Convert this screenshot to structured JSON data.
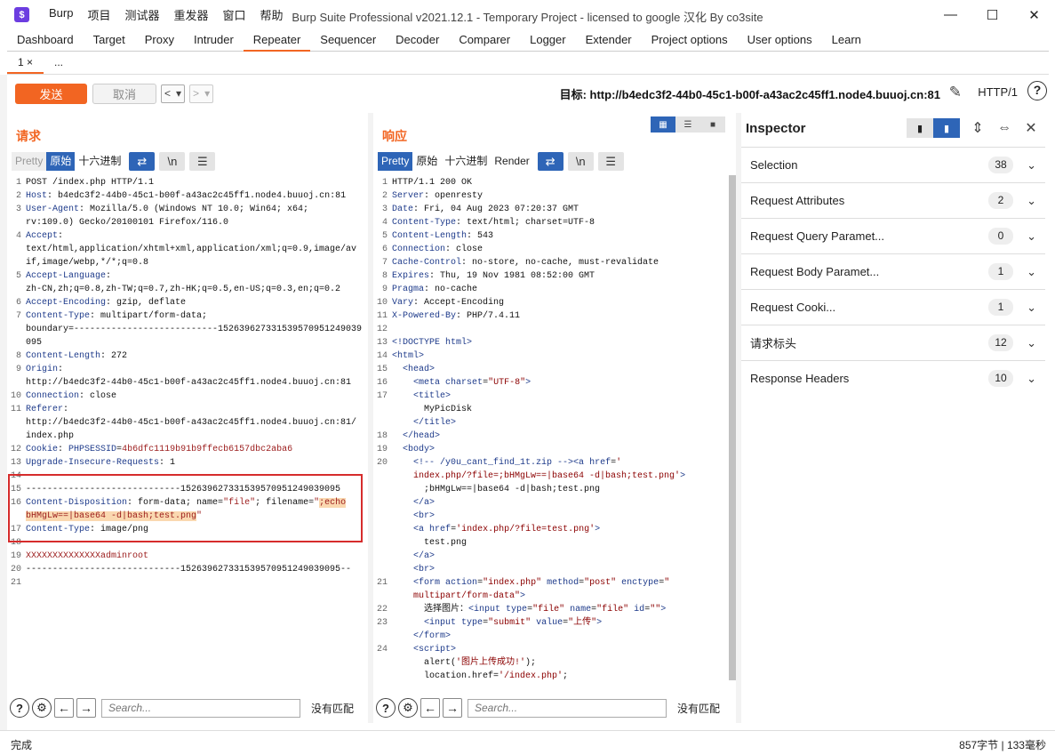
{
  "window": {
    "title": "Burp Suite Professional v2021.12.1 - Temporary Project - licensed to google 汉化 By co3site",
    "app_initial": "$",
    "min": "—",
    "max": "☐",
    "close": "✕"
  },
  "menu": [
    "Burp",
    "项目",
    "测试器",
    "重发器",
    "窗口",
    "帮助"
  ],
  "main_tabs": [
    "Dashboard",
    "Target",
    "Proxy",
    "Intruder",
    "Repeater",
    "Sequencer",
    "Decoder",
    "Comparer",
    "Logger",
    "Extender",
    "Project options",
    "User options",
    "Learn"
  ],
  "active_main_tab": "Repeater",
  "sub_tabs": [
    {
      "label": "1 ×"
    },
    {
      "label": "..."
    }
  ],
  "toolbar": {
    "send": "发送",
    "cancel": "取消",
    "back": "<",
    "back_drop": "▾",
    "fwd": ">",
    "fwd_drop": "▾",
    "target": "目标: http://b4edc3f2-44b0-45c1-b00f-a43ac2c45ff1.node4.buuoj.cn:81",
    "protocol": "HTTP/1",
    "help": "?"
  },
  "request": {
    "title": "请求",
    "views": [
      "Pretty",
      "原始",
      "十六进制"
    ],
    "active_view": "原始",
    "icons": [
      "wrap-icon",
      "newline-icon",
      "menu-icon"
    ],
    "newline": "\\n",
    "search_placeholder": "Search...",
    "no_match": "没有匹配"
  },
  "response": {
    "title": "响应",
    "views": [
      "Pretty",
      "原始",
      "十六进制",
      "Render"
    ],
    "active_view": "Pretty",
    "newline": "\\n",
    "search_placeholder": "Search...",
    "no_match": "没有匹配"
  },
  "inspector": {
    "title": "Inspector",
    "rows": [
      {
        "label": "Selection",
        "count": "38"
      },
      {
        "label": "Request Attributes",
        "count": "2"
      },
      {
        "label": "Request Query Paramet...",
        "count": "0"
      },
      {
        "label": "Request Body Paramet...",
        "count": "1"
      },
      {
        "label": "Request Cooki...",
        "count": "1"
      },
      {
        "label": "请求标头",
        "count": "12"
      },
      {
        "label": "Response Headers",
        "count": "10"
      }
    ]
  },
  "status": {
    "left": "完成",
    "right": "857字节 | 133毫秒"
  }
}
